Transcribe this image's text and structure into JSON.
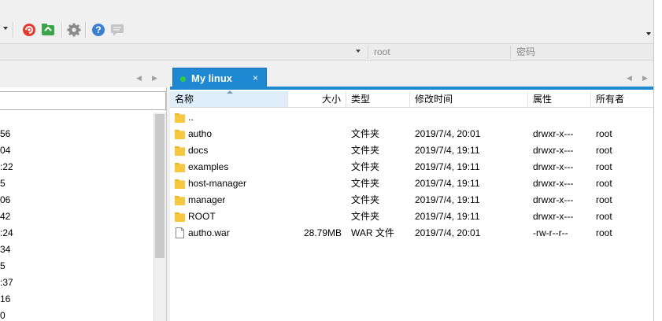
{
  "toolbar": {
    "icons": [
      "dropdown-arrow-icon",
      "red-swirl-icon",
      "green-transfer-icon",
      "gear-icon",
      "help-icon",
      "chat-icon",
      "overflow-arrow-icon"
    ]
  },
  "connection": {
    "host_value": "",
    "user_placeholder": "root",
    "password_placeholder": "密码"
  },
  "tab": {
    "label": "My linux",
    "close": "×",
    "status_color": "#2ecc40"
  },
  "left_pane": {
    "fragments": [
      "56",
      "04",
      ":22",
      "5",
      "06",
      "42",
      ":24",
      "34",
      "5",
      ":37",
      "16",
      "0"
    ]
  },
  "file_list": {
    "columns": {
      "name": "名称",
      "size": "大小",
      "type": "类型",
      "modified": "修改时间",
      "attributes": "属性",
      "owner": "所有者"
    },
    "rows": [
      {
        "name": "..",
        "size": "",
        "type": "",
        "modified": "",
        "attributes": "",
        "owner": "",
        "kind": "folder"
      },
      {
        "name": "autho",
        "size": "",
        "type": "文件夹",
        "modified": "2019/7/4, 20:01",
        "attributes": "drwxr-x---",
        "owner": "root",
        "kind": "folder"
      },
      {
        "name": "docs",
        "size": "",
        "type": "文件夹",
        "modified": "2019/7/4, 19:11",
        "attributes": "drwxr-x---",
        "owner": "root",
        "kind": "folder"
      },
      {
        "name": "examples",
        "size": "",
        "type": "文件夹",
        "modified": "2019/7/4, 19:11",
        "attributes": "drwxr-x---",
        "owner": "root",
        "kind": "folder"
      },
      {
        "name": "host-manager",
        "size": "",
        "type": "文件夹",
        "modified": "2019/7/4, 19:11",
        "attributes": "drwxr-x---",
        "owner": "root",
        "kind": "folder"
      },
      {
        "name": "manager",
        "size": "",
        "type": "文件夹",
        "modified": "2019/7/4, 19:11",
        "attributes": "drwxr-x---",
        "owner": "root",
        "kind": "folder"
      },
      {
        "name": "ROOT",
        "size": "",
        "type": "文件夹",
        "modified": "2019/7/4, 19:11",
        "attributes": "drwxr-x---",
        "owner": "root",
        "kind": "folder"
      },
      {
        "name": "autho.war",
        "size": "28.79MB",
        "type": "WAR 文件",
        "modified": "2019/7/4, 20:01",
        "attributes": "-rw-r--r--",
        "owner": "root",
        "kind": "file"
      }
    ]
  },
  "colors": {
    "accent": "#1e88d3",
    "folder": "#e8b923",
    "header_selected": "#dfeefa"
  }
}
